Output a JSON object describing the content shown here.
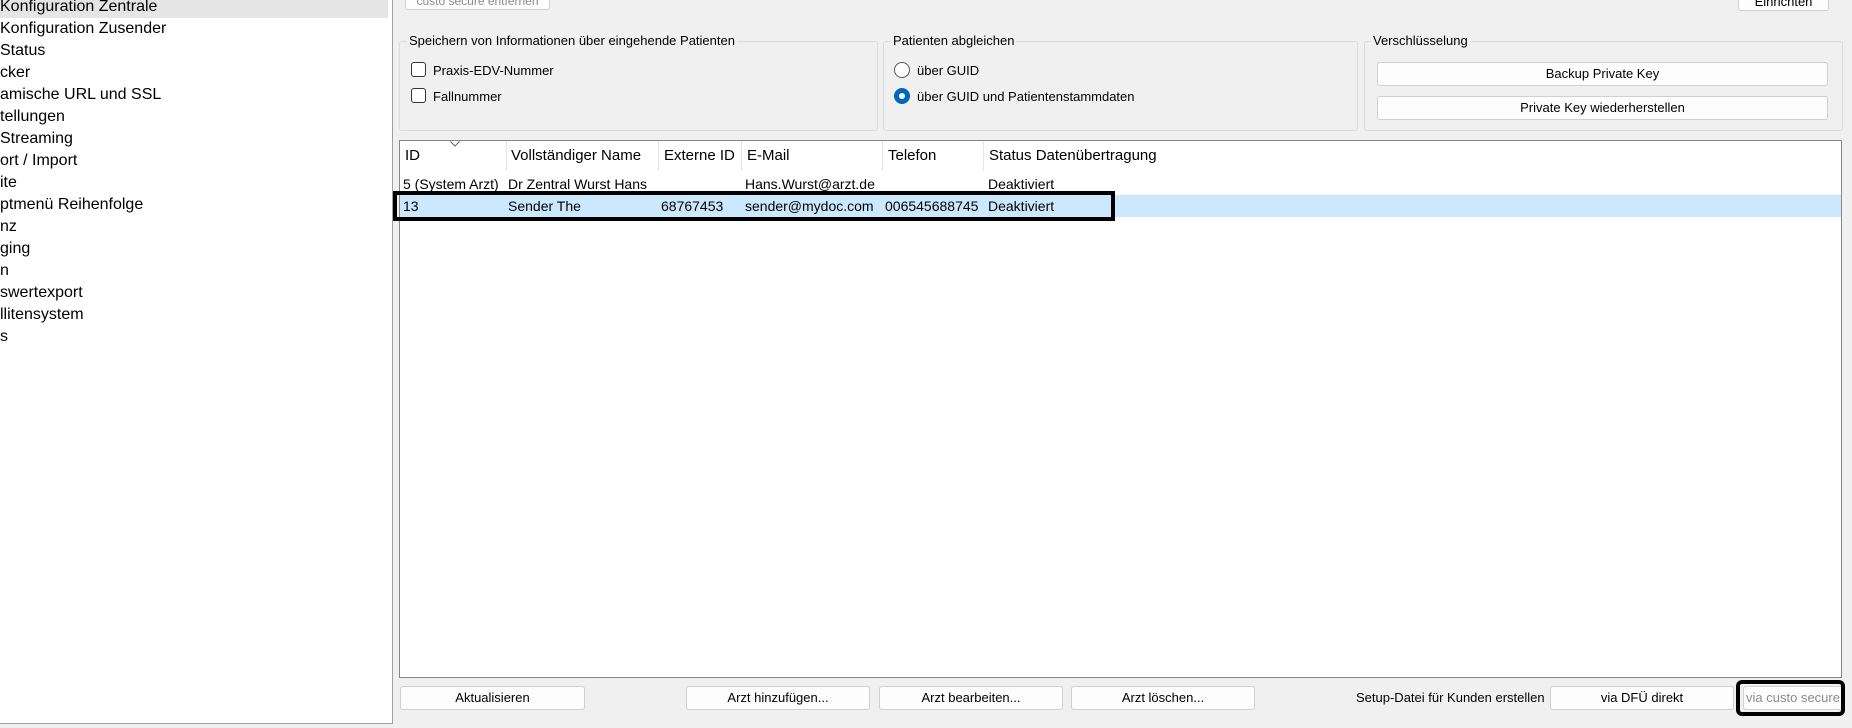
{
  "sidebar": {
    "items": [
      {
        "label": "Konfiguration Zentrale",
        "selected": true
      },
      {
        "label": "Konfiguration Zusender"
      },
      {
        "label": "Status"
      },
      {
        "label": "cker"
      },
      {
        "label": "amische URL und SSL"
      },
      {
        "label": "tellungen"
      },
      {
        "label": " Streaming"
      },
      {
        "label": "ort / Import"
      },
      {
        "label": "ite"
      },
      {
        "label": "ptmenü Reihenfolge"
      },
      {
        "label": "nz"
      },
      {
        "label": "ging"
      },
      {
        "label": "n"
      },
      {
        "label": "swertexport"
      },
      {
        "label": "llitensystem"
      },
      {
        "label": "s"
      }
    ]
  },
  "top_fragment": {
    "left_button_label": "custo secure entfernen",
    "right_button_label": "Einrichten"
  },
  "store_info": {
    "title": "Speichern von Informationen über eingehende Patienten",
    "options": [
      {
        "label": "Praxis-EDV-Nummer",
        "checked": false
      },
      {
        "label": "Fallnummer",
        "checked": false
      }
    ]
  },
  "match_patients": {
    "title": "Patienten abgleichen",
    "options": [
      {
        "label": "über GUID",
        "selected": false
      },
      {
        "label": "über GUID und Patientenstammdaten",
        "selected": true
      }
    ]
  },
  "encryption": {
    "title": "Verschlüsselung",
    "backup_label": "Backup Private Key",
    "restore_label": "Private Key wiederherstellen"
  },
  "table": {
    "columns": [
      "ID",
      "Vollständiger Name",
      "Externe ID",
      "E-Mail",
      "Telefon",
      "Status Datenübertragung"
    ],
    "rows": [
      {
        "cells": [
          "5 (System Arzt)",
          "Dr Zentral Wurst Hans",
          "",
          "Hans.Wurst@arzt.de",
          "",
          "Deaktiviert"
        ],
        "selected": false
      },
      {
        "cells": [
          "13",
          "Sender The",
          "68767453",
          "sender@mydoc.com",
          "006545688745",
          "Deaktiviert"
        ],
        "selected": true
      }
    ]
  },
  "bottom": {
    "refresh_label": "Aktualisieren",
    "add_label": "Arzt hinzufügen...",
    "edit_label": "Arzt bearbeiten...",
    "delete_label": "Arzt löschen...",
    "setup_label": "Setup-Datei für Kunden erstellen",
    "dfu_label": "via DFÜ direkt",
    "custo_label": "via custo secure"
  },
  "colors": {
    "selection": "#cce8ff",
    "accent": "#0067c0"
  }
}
